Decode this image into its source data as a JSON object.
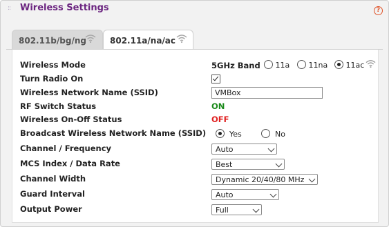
{
  "header": {
    "title": "Wireless Settings",
    "help_icon": "?"
  },
  "tabs": [
    {
      "label": "802.11b/bg/ng",
      "active": false
    },
    {
      "label": "802.11a/na/ac",
      "active": true
    }
  ],
  "form": {
    "wireless_mode": {
      "label": "Wireless Mode",
      "band": "5GHz Band",
      "options": [
        "11a",
        "11na",
        "11ac"
      ],
      "selected": "11ac"
    },
    "turn_radio_on": {
      "label": "Turn Radio On",
      "checked": true
    },
    "ssid": {
      "label": "Wireless Network Name (SSID)",
      "value": "VMBox"
    },
    "rf_switch": {
      "label": "RF Switch Status",
      "value": "ON",
      "color": "#1a8a1a"
    },
    "onoff_status": {
      "label": "Wireless On-Off Status",
      "value": "OFF",
      "color": "#e02020"
    },
    "broadcast": {
      "label": "Broadcast Wireless Network Name (SSID)",
      "yes": "Yes",
      "no": "No",
      "selected": "Yes"
    },
    "channel": {
      "label": "Channel / Frequency",
      "value": "Auto"
    },
    "mcs": {
      "label": "MCS Index / Data Rate",
      "value": "Best"
    },
    "width": {
      "label": "Channel Width",
      "value": "Dynamic 20/40/80 MHz"
    },
    "guard": {
      "label": "Guard Interval",
      "value": "Auto"
    },
    "power": {
      "label": "Output Power",
      "value": "Full"
    }
  }
}
